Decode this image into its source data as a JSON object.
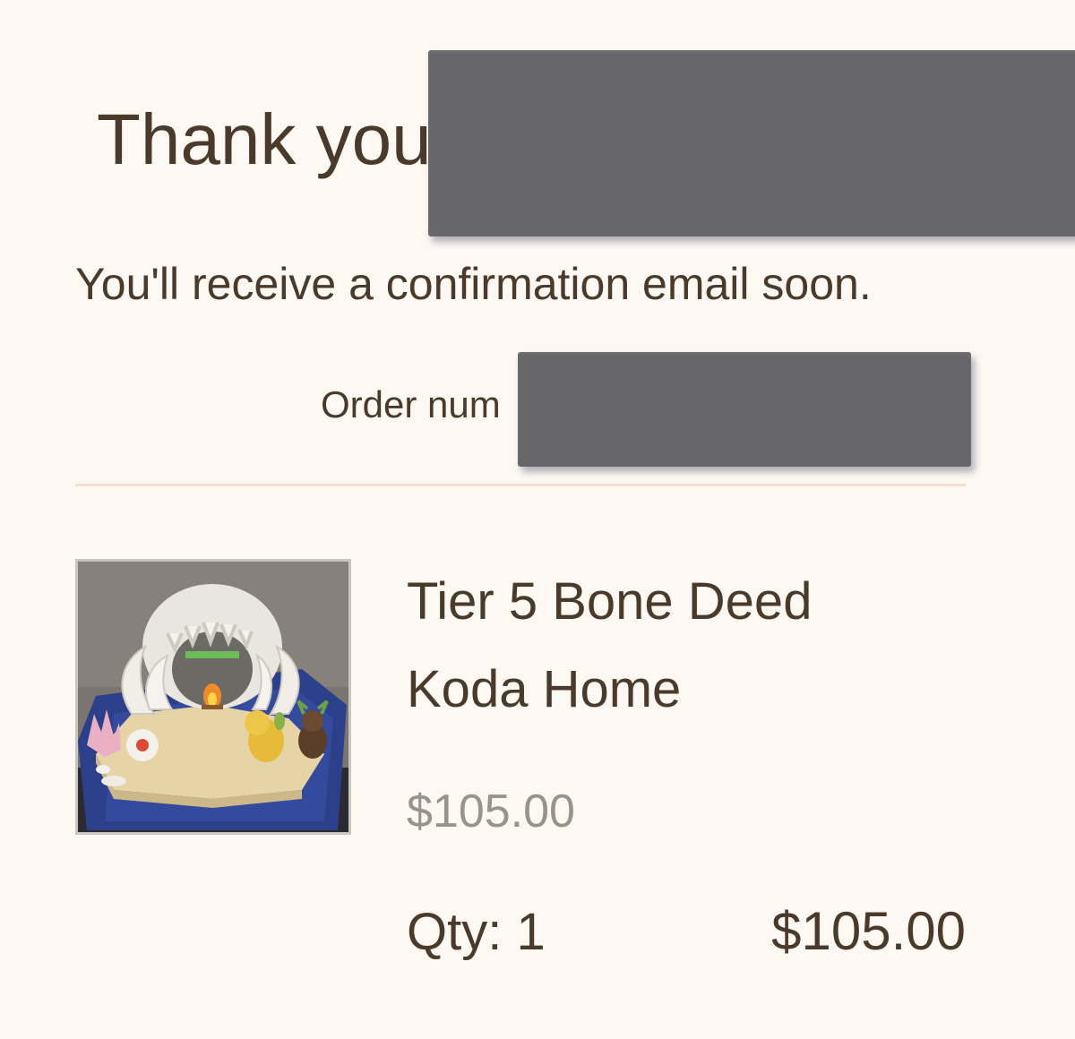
{
  "confirmation": {
    "title": "Thank you",
    "message": "You'll receive a confirmation email soon.",
    "order_label": "Order num"
  },
  "order_item": {
    "name_line1": "Tier 5 Bone Deed",
    "name_line2": "Koda Home",
    "unit_price": "$105.00",
    "quantity": "Qty: 1",
    "line_total": "$105.00"
  },
  "colors": {
    "background": "#fdf8f2",
    "text": "#4a3a2c",
    "muted_text": "#9a928b",
    "divider": "#f5ddd2",
    "redaction": "#67676a"
  }
}
